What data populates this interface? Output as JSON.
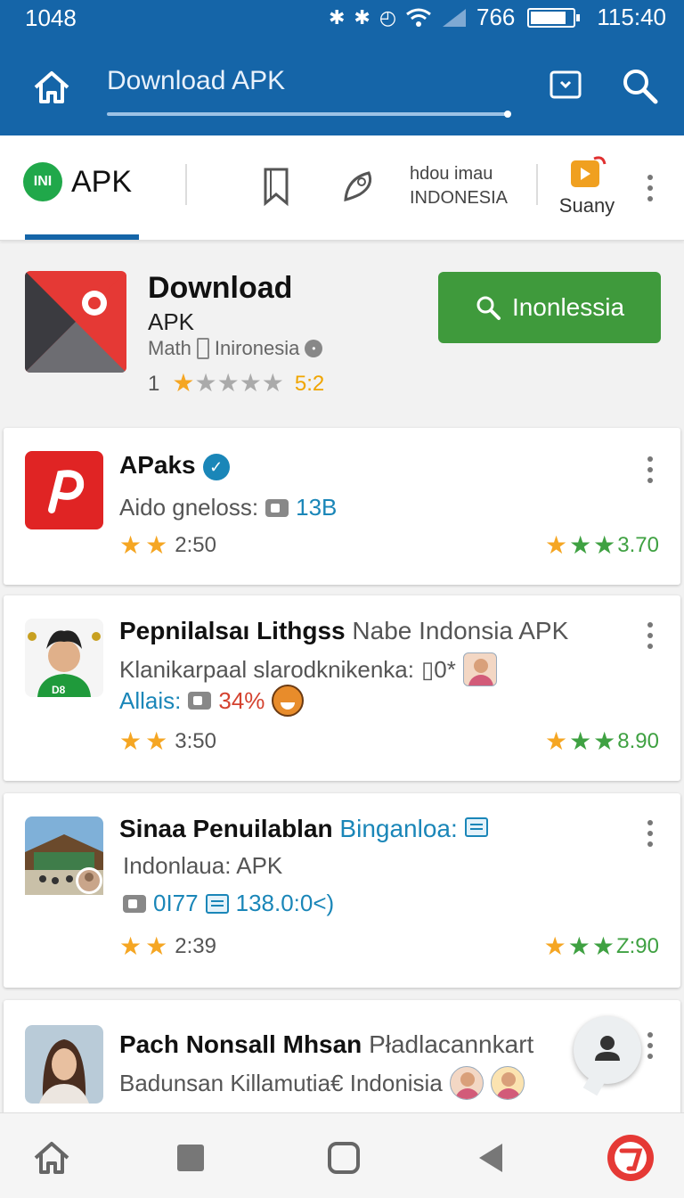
{
  "status_bar": {
    "left_text": "1048",
    "battery_text": "766",
    "battery_level": 0.85,
    "time": "115:40",
    "icons": [
      "bluetooth-icon",
      "bluetooth-icon",
      "alarm-icon",
      "wifi-icon",
      "signal-icon",
      "battery-icon"
    ]
  },
  "app_bar": {
    "search_text": "Download APK",
    "icons": [
      "home-icon",
      "cast-icon",
      "search-icon"
    ]
  },
  "tabs": {
    "apk_logo_text": "INI",
    "apk_label": "APK",
    "region_line1": "hdou imau",
    "region_line2": "INDONESIA",
    "suany_label": "Suany",
    "icons": [
      "bookmark-icon",
      "feather-icon",
      "play-icon",
      "more-icon"
    ]
  },
  "featured": {
    "title": "Download",
    "subtitle": "APK",
    "category": "Math",
    "region": "Inironesia",
    "rating_count": "1",
    "stars": 1,
    "rating_text": "5:2",
    "install_label": "Inonlessia"
  },
  "cards": [
    {
      "title": "APaks",
      "line1_label": "Aido gneloss:",
      "line1_value": "13B",
      "left_rating": "2:50",
      "right_rating": "3.70"
    },
    {
      "title": "Pepnilalsaı Lithgss",
      "title_extra": "Nabe Indonsia APK",
      "line1": "Klanikarpaal slarodknikenka:",
      "line1_suffix": "▯0*",
      "line2_label": "Allais:",
      "line2_value": "34%",
      "left_rating": "3:50",
      "right_rating": "8.90",
      "jersey_text": "D8"
    },
    {
      "title": "Sinaa Penuilablan",
      "title_extra": "Binganloa:",
      "line1": "Indonlaua: APK",
      "line2_a": "0I77",
      "line2_b": "138.0:0<)",
      "left_rating": "2:39",
      "right_rating": "Z:90"
    },
    {
      "title": "Pach Nonsall Mhsan",
      "title_extra": "Pładlacannkart",
      "line1": "Badunsan Killamutia€ Indonisia"
    }
  ],
  "colors": {
    "primary": "#1565a8",
    "install_green": "#3f9a3c",
    "star_gold": "#f5a623",
    "star_green": "#3fa142",
    "link_blue": "#1a86b8"
  }
}
